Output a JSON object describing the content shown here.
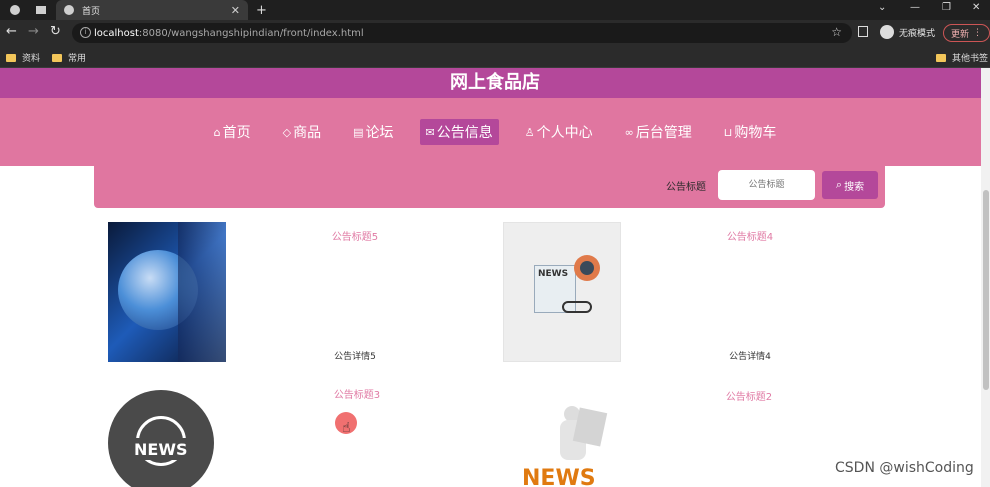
{
  "browser": {
    "tab_title": "首页",
    "url_host": "localhost",
    "url_rest": ":8080/wangshangshipindian/front/index.html",
    "incognito_label": "无痕模式",
    "update_label": "更新",
    "bookmarks": [
      "资料",
      "常用"
    ],
    "other_bookmarks": "其他书签"
  },
  "site": {
    "title": "网上食品店",
    "nav": [
      {
        "label": "首页",
        "icon": "home-icon"
      },
      {
        "label": "商品",
        "icon": "tag-icon"
      },
      {
        "label": "论坛",
        "icon": "forum-icon"
      },
      {
        "label": "公告信息",
        "icon": "mail-icon"
      },
      {
        "label": "个人中心",
        "icon": "user-icon"
      },
      {
        "label": "后台管理",
        "icon": "link-icon"
      },
      {
        "label": "购物车",
        "icon": "cart-icon"
      }
    ]
  },
  "search": {
    "label": "公告标题",
    "placeholder": "公告标题",
    "button_label": "搜索"
  },
  "news": [
    {
      "title": "公告标题5",
      "detail": "公告详情5",
      "image": "globe-news-image"
    },
    {
      "title": "公告标题4",
      "detail": "公告详情4",
      "image": "newspaper-image"
    },
    {
      "title": "公告标题3",
      "detail": "",
      "image": "news-globe-icon-image"
    },
    {
      "title": "公告标题2",
      "detail": "",
      "image": "news-figure-image"
    }
  ],
  "watermark": "CSDN @wishCoding",
  "colors": {
    "header": "#b4489a",
    "nav": "#e076a0",
    "title_pink": "#e07aa4"
  }
}
